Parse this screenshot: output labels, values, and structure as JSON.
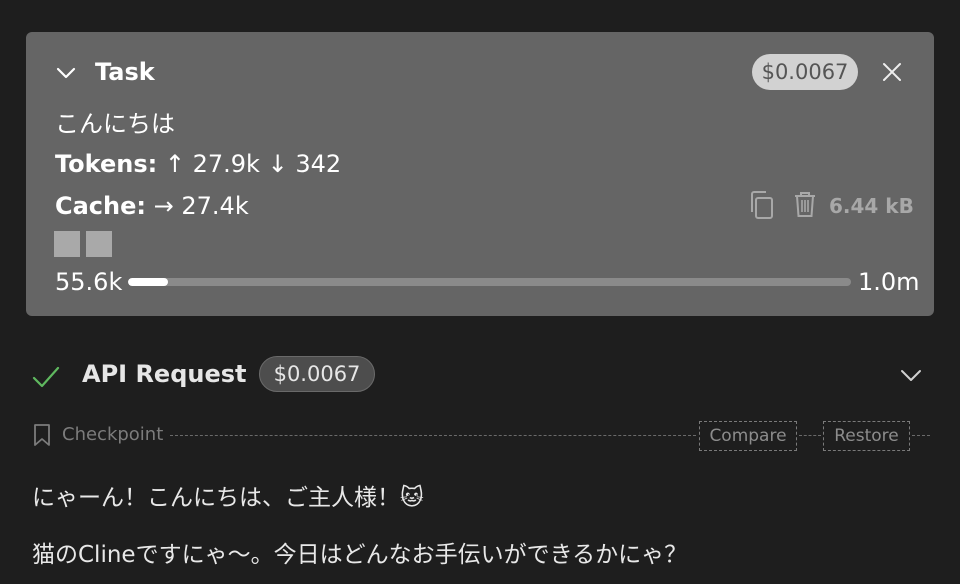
{
  "task": {
    "title": "Task",
    "cost": "$0.0067",
    "text": "こんにちは",
    "tokens_label": "Tokens:",
    "tokens_in": "↑ 27.9k",
    "tokens_out": "↓ 342",
    "cache_label": "Cache:",
    "cache_value": "→ 27.4k",
    "size": "6.44 kB",
    "context_used": "55.6k",
    "context_max": "1.0m",
    "context_fraction": 0.0556,
    "icons": [
      "chevron-down-icon",
      "close-icon",
      "copy-icon",
      "trash-icon"
    ]
  },
  "api_request": {
    "title": "API Request",
    "cost": "$0.0067",
    "status_color": "#5fb85f",
    "icons": [
      "check-icon",
      "chevron-down-icon"
    ]
  },
  "checkpoint": {
    "label": "Checkpoint",
    "compare": "Compare",
    "restore": "Restore",
    "icons": [
      "bookmark-icon"
    ]
  },
  "messages": [
    "にゃーん！こんにちは、ご主人様！🐱",
    "猫のClineですにゃ〜。今日はどんなお手伝いができるかにゃ？"
  ]
}
